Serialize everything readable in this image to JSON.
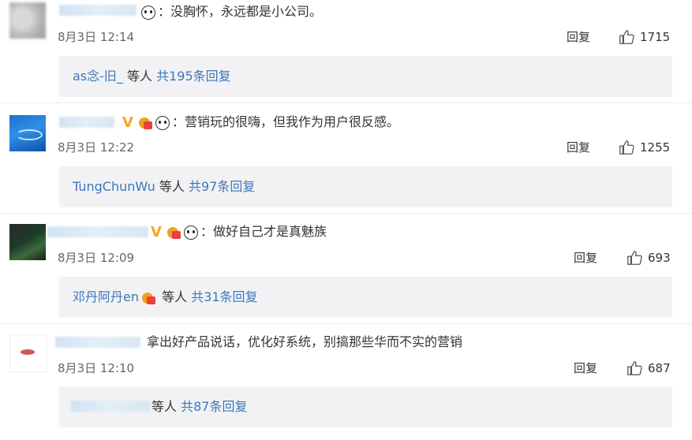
{
  "comments": [
    {
      "text": "：没胸怀，永远都是小公司。",
      "date": "8月3日 12:14",
      "reply_label": "回复",
      "likes": "1715",
      "sub": {
        "name": "as念-旧_",
        "suffix": " 等人",
        "count_link": "共195条回复"
      }
    },
    {
      "text": "：营销玩的很嗨，但我作为用户很反感。",
      "date": "8月3日 12:22",
      "reply_label": "回复",
      "likes": "1255",
      "sub": {
        "name": "TungChunWu",
        "suffix": " 等人",
        "count_link": "共97条回复"
      }
    },
    {
      "text": "：做好自己才是真魅族",
      "date": "8月3日 12:09",
      "reply_label": "回复",
      "likes": "693",
      "sub": {
        "name": "邓丹阿丹en",
        "suffix": " 等人",
        "count_link": "共31条回复"
      }
    },
    {
      "text": "拿出好产品说话，优化好系统，别搞那些华而不实的营销",
      "date": "8月3日 12:10",
      "reply_label": "回复",
      "likes": "687",
      "sub": {
        "name": "",
        "suffix": "等人",
        "count_link": "共87条回复"
      }
    }
  ],
  "icons": {
    "like": "thumbs-up-icon",
    "panda": "panda-icon",
    "vip": "crown-icon",
    "verified": "v-icon"
  },
  "colors": {
    "link": "#3b78b8",
    "sub_bg": "#f2f2f5",
    "text": "#333333",
    "meta": "#666666"
  }
}
